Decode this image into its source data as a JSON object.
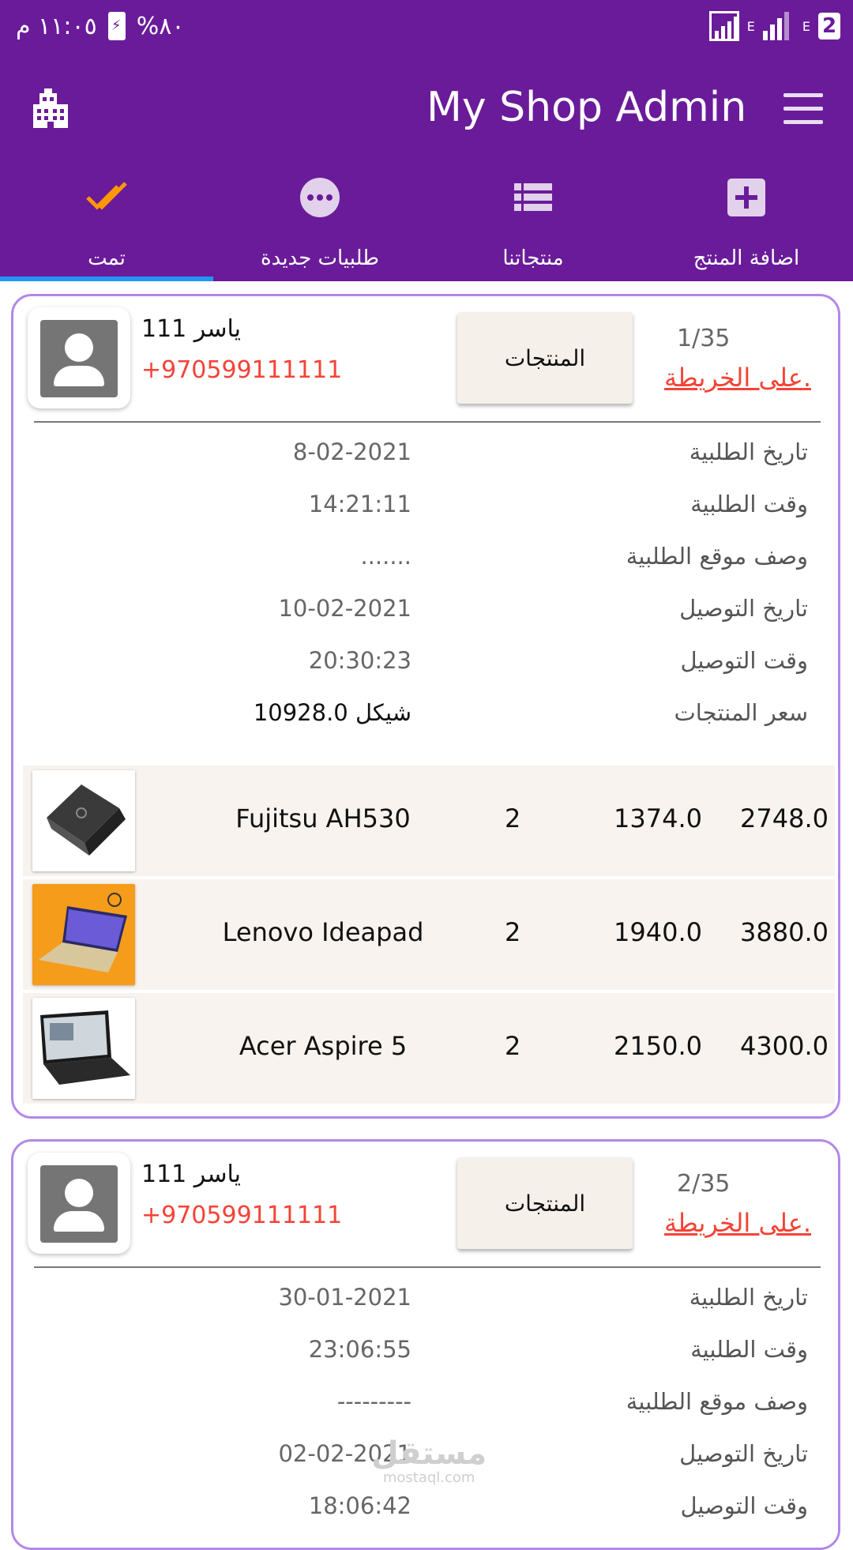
{
  "status_bar": {
    "time": "١١:٠٥ م",
    "battery": "%٨٠",
    "sim_badge": "2",
    "net_e": "E"
  },
  "toolbar": {
    "title": "My Shop Admin"
  },
  "tabs": [
    {
      "label": "تمت",
      "icon": "double-check-icon",
      "active": true
    },
    {
      "label": "طلبيات جديدة",
      "icon": "more-circle-icon",
      "active": false
    },
    {
      "label": "منتجاتنا",
      "icon": "list-icon",
      "active": false
    },
    {
      "label": "اضافة المنتج",
      "icon": "add-box-icon",
      "active": false
    }
  ],
  "orders": [
    {
      "customer": "ياسر 111",
      "phone": "+970599111111",
      "products_button": "المنتجات",
      "counter": "1/35",
      "map_link": "على الخريطة.",
      "fields": [
        {
          "label": "تاريخ الطلبية",
          "value": "8-02-2021"
        },
        {
          "label": "وقت الطلبية",
          "value": "14:21:11"
        },
        {
          "label": "وصف موقع الطلبية",
          "value": "......."
        },
        {
          "label": "تاريخ التوصيل",
          "value": "10-02-2021"
        },
        {
          "label": "وقت التوصيل",
          "value": "20:30:23"
        },
        {
          "label": "سعر المنتجات",
          "value": "10928.0 شيكل"
        }
      ],
      "products": [
        {
          "name": "Fujitsu AH530",
          "qty": "2",
          "price": "1374.0",
          "total": "2748.0",
          "thumb": "laptop-black"
        },
        {
          "name": "Lenovo Ideapad",
          "qty": "2",
          "price": "1940.0",
          "total": "3880.0",
          "thumb": "laptop-gold"
        },
        {
          "name": "Acer Aspire 5",
          "qty": "2",
          "price": "2150.0",
          "total": "4300.0",
          "thumb": "laptop-acer"
        }
      ]
    },
    {
      "customer": "ياسر 111",
      "phone": "+970599111111",
      "products_button": "المنتجات",
      "counter": "2/35",
      "map_link": "على الخريطة.",
      "fields": [
        {
          "label": "تاريخ الطلبية",
          "value": "30-01-2021"
        },
        {
          "label": "وقت الطلبية",
          "value": "23:06:55"
        },
        {
          "label": "وصف موقع الطلبية",
          "value": "---------"
        },
        {
          "label": "تاريخ التوصيل",
          "value": "02-02-2021"
        },
        {
          "label": "وقت التوصيل",
          "value": "18:06:42"
        }
      ]
    }
  ],
  "watermark": {
    "arabic": "مستقل",
    "latin": "mostaql.com"
  }
}
